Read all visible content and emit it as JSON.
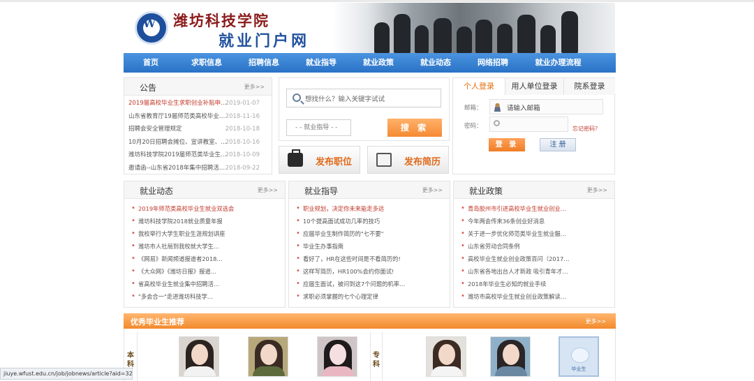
{
  "header": {
    "school_name": "潍坊科技学院",
    "portal_name": "就业门户网"
  },
  "nav": [
    "首页",
    "求职信息",
    "招聘信息",
    "就业指导",
    "就业政策",
    "就业动态",
    "网络招聘",
    "就业办理流程"
  ],
  "announcements": {
    "title": "公告",
    "more": "更多>>",
    "items": [
      {
        "title": "2019届高校毕业生求职创业补贴申…",
        "date": "2019-01-07"
      },
      {
        "title": "山东省教育厅19届师范类高校毕业…",
        "date": "2018-11-16"
      },
      {
        "title": "招聘会安全管理规定",
        "date": "2018-10-18"
      },
      {
        "title": "10月20日招聘会摊位、宣讲教室、…",
        "date": "2018-10-16"
      },
      {
        "title": "潍坊科技学院2019届师范类毕业生…",
        "date": "2018-10-09"
      },
      {
        "title": "邀请函--山东省2018年集中招聘活…",
        "date": "2018-09-22"
      }
    ]
  },
  "search": {
    "placeholder": "想找什么？输入关键字试试",
    "category": "- - 就业指导 - -",
    "button": "搜 索",
    "publish_job": "发布职位",
    "publish_resume": "发布简历"
  },
  "login": {
    "tabs": [
      "个人登录",
      "用人单位登录",
      "院系登录"
    ],
    "email_label": "邮箱：",
    "email_placeholder": "请输入邮箱",
    "password_label": "密码：",
    "forgot": "忘记密码？",
    "login_button": "登 录",
    "register_button": "注 册"
  },
  "news": {
    "title": "就业动态",
    "more": "更多>>",
    "items": [
      "2019年师范类高校毕业生就业双选会",
      "潍坊科技学院2018就业质量年报",
      "我校举行大学生职业生涯规划讲座",
      "潍坊市人社局到我校就大学生…",
      "《网易》新闻频道报道者2018…",
      "《大众网》《潍坊日报》报道…",
      "省高校毕业生就业集中招聘活…",
      "\"多会合一\"走进潍坊科技学…"
    ]
  },
  "guidance": {
    "title": "就业指导",
    "more": "更多>>",
    "items": [
      "职业规划，决定你未来能走多远",
      "10个提高面试成功几率的技巧",
      "应届毕业生制作简历的\"七不要\"",
      "毕业生办事指南",
      "看好了，HR在这些时间是不看简历的!",
      "这样写简历，HR100%会约你面试!",
      "应届生面试，被问到这7个问题的机率…",
      "求职必须掌握的七个心理定律"
    ]
  },
  "policy": {
    "title": "就业政策",
    "more": "更多>>",
    "items": [
      "青岛胶州市引进高校毕业生就业创业…",
      "今年两会传来36条创业好消息",
      "关于进一步优化师范类毕业生就业服…",
      "山东省劳动合同条例",
      "高校毕业生就业创业政策百问（2017…",
      "山东省各地出台人才新政 吸引青年才…",
      "2018年毕业生必知的就业手续",
      "潍坊市高校毕业生就业创业政策解读…"
    ]
  },
  "graduates": {
    "title": "优秀毕业生推荐",
    "more": "更多>>",
    "undergrad_label": "本科",
    "college_label": "专科",
    "placeholder_text": "毕业生"
  },
  "status_url": "jiuye.wfust.edu.cn/job/jobnews/article?aid=324",
  "colors": {
    "nav_blue": "#2a72c6",
    "accent_orange": "#f28a2c",
    "link_red": "#c0392b"
  }
}
